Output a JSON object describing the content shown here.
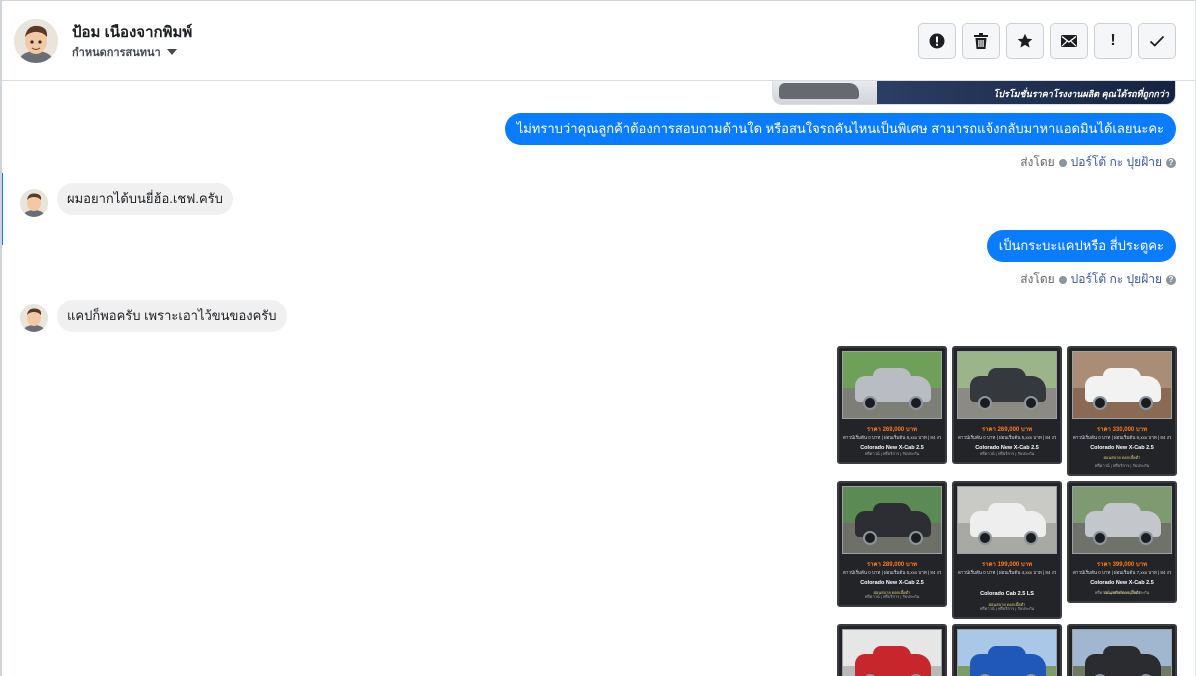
{
  "header": {
    "contact_name": "ป้อม เนืองจากพิมพ์",
    "stage_label": "กำหนดการสนทนา",
    "actions": [
      {
        "name": "report-button",
        "icon": "alert-circle-icon"
      },
      {
        "name": "delete-button",
        "icon": "trash-icon"
      },
      {
        "name": "star-button",
        "icon": "star-icon"
      },
      {
        "name": "mark-unread-button",
        "icon": "envelope-icon"
      },
      {
        "name": "important-button",
        "icon": "exclamation-icon"
      },
      {
        "name": "mark-done-button",
        "icon": "checkmark-icon"
      }
    ]
  },
  "banner": {
    "caption": "โปรโมชั่นราคาโรงงานผลิต คุณได้รถที่ถูกกว่า"
  },
  "messages": [
    {
      "direction": "out",
      "text": "ไม่ทราบว่าคุณลูกค้าต้องการสอบถามด้านใด หรือสนใจรถคันไหนเป็นพิเศษ สามารถแจ้งกลับมาหาแอดมินได้เลยนะคะ",
      "sent_by_label": "ส่งโดย",
      "agent": "ปอร์โต้ กะ ปุยฝ้าย"
    },
    {
      "direction": "in",
      "text": "ผมอยากได้บนยี่ฮ้อ.เชฟ.ครับ"
    },
    {
      "direction": "out",
      "text": "เป็นกระบะแคปหรือ สี่ประตูคะ",
      "sent_by_label": "ส่งโดย",
      "agent": "ปอร์โต้ กะ ปุยฝ้าย"
    },
    {
      "direction": "in",
      "text": "แคปก็พอครับ  เพราะเอาไว้ขนของครับ"
    }
  ],
  "cars": [
    {
      "price": "ราคา 269,000 บาท",
      "spec": "ดาวน์เริ่มต้น 0 บาท | ผ่อนเริ่มต้น 5,xxx บาท | 84 งวด",
      "model": "Colorado New X-Cab 2.5",
      "note": "",
      "foot": "ฟรีดาวน์ | ฟรีบริการ | รับประกัน",
      "color": "#b9bcc1",
      "sky": "#6fa05a",
      "ground": "#7d7f76"
    },
    {
      "price": "ราคา 269,000 บาท",
      "spec": "ดาวน์เริ่มต้น 0 บาท | ผ่อนเริ่มต้น 5,xxx บาท | 84 งวด",
      "model": "Colorado New X-Cab 2.5",
      "note": "",
      "foot": "ฟรีดาวน์ | ฟรีบริการ | รับประกัน",
      "color": "#35383d",
      "sky": "#9bb48a",
      "ground": "#8b8b84"
    },
    {
      "price": "ราคา 330,000 บาท",
      "spec": "ดาวน์เริ่มต้น 0 บาท | ผ่อนเริ่มต้น 6,xxx บาท | 84 งวด",
      "model": "Colorado New X-Cab 2.5",
      "note": "ผ่อนสบาย ดอกเบี้ยต่ำ",
      "foot": "ฟรีดาวน์ | ฟรีบริการ | รับประกัน",
      "color": "#f2f2f2",
      "sky": "#a98d76",
      "ground": "#8a6a52"
    },
    {
      "price": "ราคา 289,000 บาท",
      "spec": "ดาวน์เริ่มต้น 0 บาท | ผ่อนเริ่มต้น 5,xxx บาท | 84 งวด",
      "model": "Colorado New X-Cab 2.5",
      "note": "ผ่อนสบาย ดอกเบี้ยต่ำ",
      "foot": "ฟรีดาวน์ | ฟรีบริการ | รับประกัน",
      "color": "#2c2e33",
      "sky": "#5c8a55",
      "ground": "#6d6f68"
    },
    {
      "price": "ราคา 199,000 บาท",
      "spec": "ดาวน์เริ่มต้น 0 บาท | ผ่อนเริ่มต้น 4,xxx บาท | 84 งวด",
      "model": "Colorado Cab 2.5 LS",
      "note": "ผ่อนสบาย ดอกเบี้ยต่ำ",
      "foot": "ฟรีดาวน์ | ฟรีบริการ | รับประกัน",
      "color": "#eeeeee",
      "sky": "#c9c9c6",
      "ground": "#a8a8a4"
    },
    {
      "price": "ราคา 399,000 บาท",
      "spec": "ดาวน์เริ่มต้น 0 บาท | ผ่อนเริ่มต้น 7,xxx บาท | 84 งวด",
      "model": "Colorado New X-Cab 2.5",
      "note": "ผ่อนสบาย ดอกเบี้ยต่ำ",
      "foot": "ฟรีดาวน์ | ฟรีบริการ | รับประกัน",
      "color": "#c3c6ca",
      "sky": "#7d9a70",
      "ground": "#6f716b"
    },
    {
      "price": "",
      "spec": "",
      "model": "",
      "note": "",
      "foot": "",
      "color": "#c8262d",
      "sky": "#e6e6e6",
      "ground": "#b9b9b9"
    },
    {
      "price": "",
      "spec": "",
      "model": "",
      "note": "",
      "foot": "",
      "color": "#1f58b8",
      "sky": "#a9c8e8",
      "ground": "#7a9c6a"
    },
    {
      "price": "",
      "spec": "",
      "model": "",
      "note": "",
      "foot": "",
      "color": "#2a2c30",
      "sky": "#a0b7cf",
      "ground": "#6e7a63"
    }
  ],
  "colors": {
    "accent": "#0a7cff",
    "incoming_bubble": "#f0f0f0",
    "active_strip": "#1877f2"
  }
}
